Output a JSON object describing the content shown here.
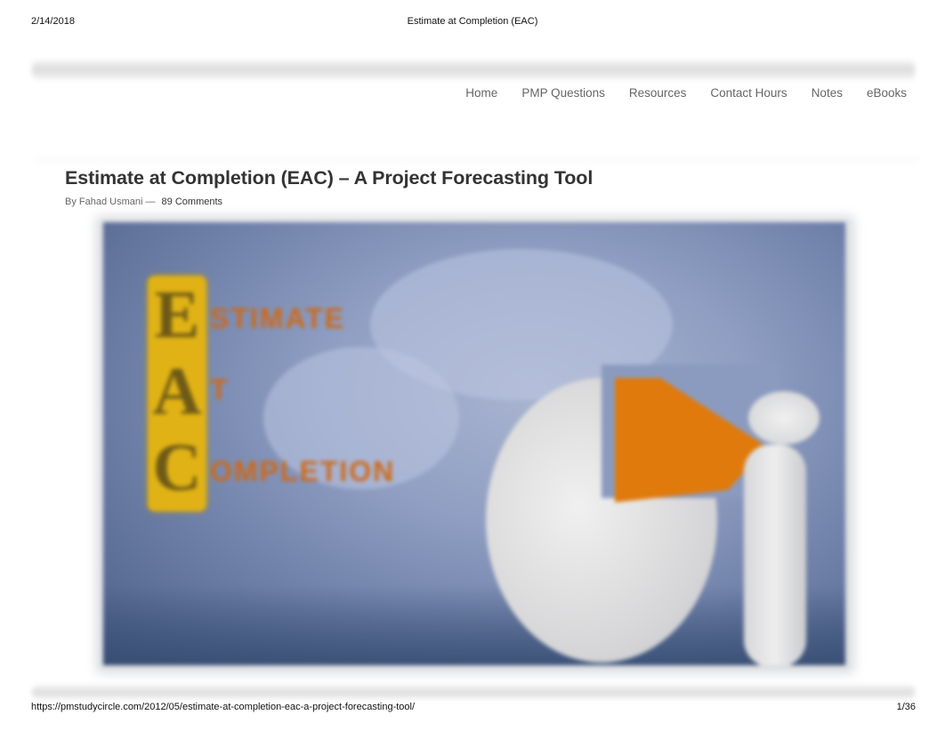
{
  "print_header": {
    "date": "2/14/2018",
    "title": "Estimate at Completion (EAC)"
  },
  "nav": {
    "items": [
      {
        "label": "Home"
      },
      {
        "label": "PMP Questions"
      },
      {
        "label": "Resources"
      },
      {
        "label": "Contact Hours"
      },
      {
        "label": "Notes"
      },
      {
        "label": "eBooks"
      }
    ]
  },
  "article": {
    "title": "Estimate at Completion (EAC) – A Project Forecasting Tool",
    "byline_prefix": "By Fahad Usmani —",
    "comments_link": "89 Comments",
    "hero_image": {
      "alt": "Estimate At Completion illustration",
      "letters": [
        "E",
        "A",
        "C"
      ],
      "words": [
        "STIMATE",
        "T",
        "OMPLETION"
      ],
      "colors": {
        "strip": "#e0b215",
        "orange": "#e07a0c",
        "background": "#8f9ec2"
      }
    }
  },
  "print_footer": {
    "url": "https://pmstudycircle.com/2012/05/estimate-at-completion-eac-a-project-forecasting-tool/",
    "page": "1/36"
  }
}
